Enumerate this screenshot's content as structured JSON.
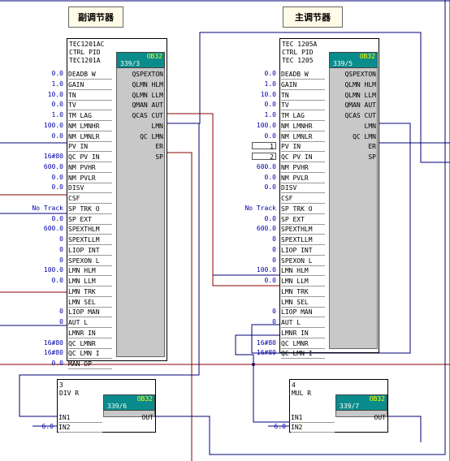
{
  "titles": {
    "left": "副调节器",
    "right": "主调节器"
  },
  "block1": {
    "header": [
      "TEC1201AC",
      "CTRL PID",
      "TEC1201A"
    ],
    "ob": "OB32",
    "ob_num": "339/3",
    "inputs": [
      {
        "name": "DEADB W",
        "value": "0.0"
      },
      {
        "name": "GAIN",
        "value": "1.0"
      },
      {
        "name": "TN",
        "value": "10.0"
      },
      {
        "name": "TV",
        "value": "0.0"
      },
      {
        "name": "TM LAG",
        "value": "1.0"
      },
      {
        "name": "NM LMNHR",
        "value": "100.0"
      },
      {
        "name": "NM LMNLR",
        "value": "0.0"
      },
      {
        "name": "PV IN",
        "value": ""
      },
      {
        "name": "QC PV IN",
        "value": "16#80"
      },
      {
        "name": "NM PVHR",
        "value": "600.0"
      },
      {
        "name": "NM PVLR",
        "value": "0.0"
      },
      {
        "name": "DISV",
        "value": "0.0"
      },
      {
        "name": "CSF",
        "value": ""
      },
      {
        "name": "SP TRK O",
        "value": "No Track"
      },
      {
        "name": "SP EXT",
        "value": "0.0"
      },
      {
        "name": "SPEXTHLM",
        "value": "600.0"
      },
      {
        "name": "SPEXTLLM",
        "value": "0"
      },
      {
        "name": "LIOP INT",
        "value": "0"
      },
      {
        "name": "SPEXON L",
        "value": "0"
      },
      {
        "name": "LMN HLM",
        "value": "100.0"
      },
      {
        "name": "LMN LLM",
        "value": "0.0"
      },
      {
        "name": "LMN TRK",
        "value": ""
      },
      {
        "name": "LMN SEL",
        "value": ""
      },
      {
        "name": "LIOP MAN",
        "value": "0"
      },
      {
        "name": "AUT L",
        "value": "0"
      },
      {
        "name": "LMNR IN",
        "value": ""
      },
      {
        "name": "QC LMNR",
        "value": "16#80"
      },
      {
        "name": "QC LMN I",
        "value": "16#80"
      },
      {
        "name": "MAN OP",
        "value": "0.0"
      }
    ],
    "outputs": [
      "QSPEXTON",
      "QLMN HLM",
      "QLMN LLM",
      "QMAN AUT",
      "QCAS CUT",
      "LMN",
      "QC LMN",
      "ER",
      "SP"
    ]
  },
  "block2": {
    "header": [
      "TEC 1205A",
      "CTRL PID",
      "TEC 1205"
    ],
    "ob": "OB32",
    "ob_num": "339/5",
    "inputs": [
      {
        "name": "DEADB W",
        "value": "0.0"
      },
      {
        "name": "GAIN",
        "value": "1.0"
      },
      {
        "name": "TN",
        "value": "10.0"
      },
      {
        "name": "TV",
        "value": "0.0"
      },
      {
        "name": "TM LAG",
        "value": "1.0"
      },
      {
        "name": "NM LMNHR",
        "value": "100.0"
      },
      {
        "name": "NM LMNLR",
        "value": "0.0"
      },
      {
        "name": "PV IN",
        "value": ""
      },
      {
        "name": "QC PV IN",
        "value": ""
      },
      {
        "name": "NM PVHR",
        "value": "600.0"
      },
      {
        "name": "NM PVLR",
        "value": "0.0"
      },
      {
        "name": "DISV",
        "value": "0.0"
      },
      {
        "name": "CSF",
        "value": ""
      },
      {
        "name": "SP TRK O",
        "value": "No Track"
      },
      {
        "name": "SP EXT",
        "value": "0.0"
      },
      {
        "name": "SPEXTHLM",
        "value": "600.0"
      },
      {
        "name": "SPEXTLLM",
        "value": "0"
      },
      {
        "name": "LIOP INT",
        "value": "0"
      },
      {
        "name": "SPEXON L",
        "value": "0"
      },
      {
        "name": "LMN HLM",
        "value": "100.0"
      },
      {
        "name": "LMN LLM",
        "value": "0.0"
      },
      {
        "name": "LMN TRK",
        "value": ""
      },
      {
        "name": "LMN SEL",
        "value": ""
      },
      {
        "name": "LIOP MAN",
        "value": "0"
      },
      {
        "name": "AUT L",
        "value": "0"
      },
      {
        "name": "LMNR IN",
        "value": ""
      },
      {
        "name": "QC LMNR",
        "value": "16#80"
      },
      {
        "name": "QC LMN I",
        "value": "16#80"
      }
    ],
    "signals": [
      "1",
      "2"
    ],
    "outputs": [
      "QSPEXTON",
      "QLMN HLM",
      "QLMN LLM",
      "QMAN AUT",
      "QCAS CUT",
      "LMN",
      "QC LMN",
      "ER",
      "SP"
    ]
  },
  "block3": {
    "header": [
      "3",
      "DIV R"
    ],
    "ob": "OB32",
    "ob_num": "339/6",
    "inputs": [
      {
        "name": "IN1",
        "value": ""
      },
      {
        "name": "IN2",
        "value": "6.0"
      }
    ],
    "outputs": [
      "OUT"
    ]
  },
  "block4": {
    "header": [
      "4",
      "MUL R"
    ],
    "ob": "OB32",
    "ob_num": "339/7",
    "inputs": [
      {
        "name": "IN1",
        "value": ""
      },
      {
        "name": "IN2",
        "value": "6.0"
      }
    ],
    "outputs": [
      "OUT"
    ]
  },
  "colors": {
    "wire_blue": "#00007a",
    "wire_red": "#8b0000",
    "block_body": "#c8c8c8",
    "ob_box": "#0a8c8c"
  }
}
